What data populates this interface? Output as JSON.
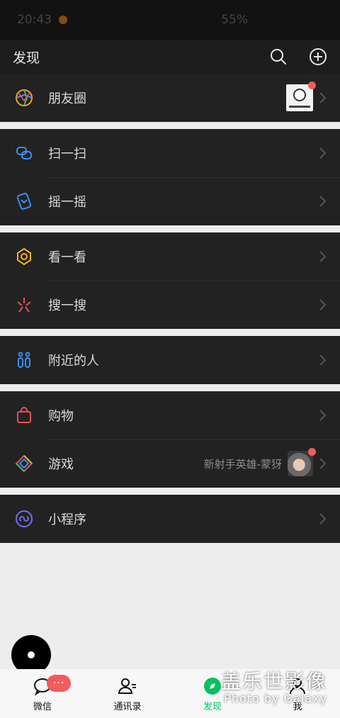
{
  "status_bar": {
    "time": "20:43",
    "battery": "55%"
  },
  "header": {
    "title": "发现",
    "search_icon": "search-icon",
    "add_icon": "plus-circle-icon"
  },
  "groups": [
    [
      {
        "label": "朋友圈",
        "icon": "moments-icon",
        "has_dot": true
      }
    ],
    [
      {
        "label": "扫一扫",
        "icon": "scan-icon"
      },
      {
        "label": "摇一摇",
        "icon": "shake-icon"
      }
    ],
    [
      {
        "label": "看一看",
        "icon": "top-stories-icon"
      },
      {
        "label": "搜一搜",
        "icon": "search-star-icon"
      }
    ],
    [
      {
        "label": "附近的人",
        "icon": "people-nearby-icon"
      }
    ],
    [
      {
        "label": "购物",
        "icon": "shopping-bag-icon"
      },
      {
        "label": "游戏",
        "icon": "games-icon",
        "subtitle": "新射手英雄-蒙犽",
        "has_dot": true
      }
    ],
    [
      {
        "label": "小程序",
        "icon": "mini-programs-icon"
      }
    ]
  ],
  "tabs": [
    {
      "label": "微信",
      "icon": "chat-bubble-icon",
      "badge": "···"
    },
    {
      "label": "通讯录",
      "icon": "contacts-icon"
    },
    {
      "label": "发现",
      "icon": "compass-icon",
      "active": true
    },
    {
      "label": "我",
      "icon": "person-icon"
    }
  ],
  "watermark": {
    "cn": "盖乐世影像",
    "en": "Photo by Galaxy"
  },
  "colors": {
    "accent": "#07c160",
    "badge": "#f25c5c",
    "row_bg": "#222222"
  }
}
